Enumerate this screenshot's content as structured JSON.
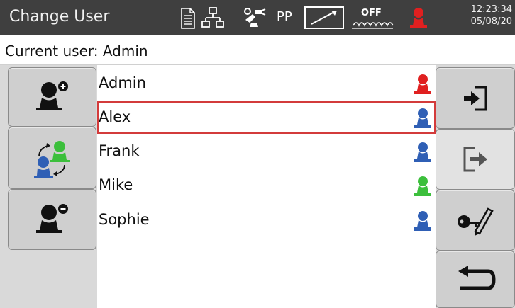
{
  "header": {
    "title": "Change User",
    "status_mode": "PP",
    "status_off": "OFF",
    "time": "12:23:34",
    "date": "05/08/20",
    "icons": [
      "document-icon",
      "network-icon",
      "robot-tool-icon",
      "pp-label",
      "speed-ramp-icon",
      "heater-off-icon",
      "current-user-icon"
    ],
    "colors": {
      "bar": "#3f3f3f",
      "current_user": "#e02020"
    }
  },
  "current_user": {
    "text": "Current user: Admin"
  },
  "users": [
    {
      "name": "Admin",
      "role_color": "#e02020",
      "selected": false
    },
    {
      "name": "Alex",
      "role_color": "#2f5fb5",
      "selected": true
    },
    {
      "name": "Frank",
      "role_color": "#2f5fb5",
      "selected": false
    },
    {
      "name": "Mike",
      "role_color": "#3cbf3c",
      "selected": false
    },
    {
      "name": "Sophie",
      "role_color": "#2f5fb5",
      "selected": false
    }
  ],
  "left_buttons": [
    "add-user-icon",
    "switch-user-icon",
    "remove-user-icon"
  ],
  "right_buttons": [
    "login-icon",
    "logout-icon",
    "password-icon",
    "back-icon"
  ],
  "selection_color": "#d33b3b"
}
